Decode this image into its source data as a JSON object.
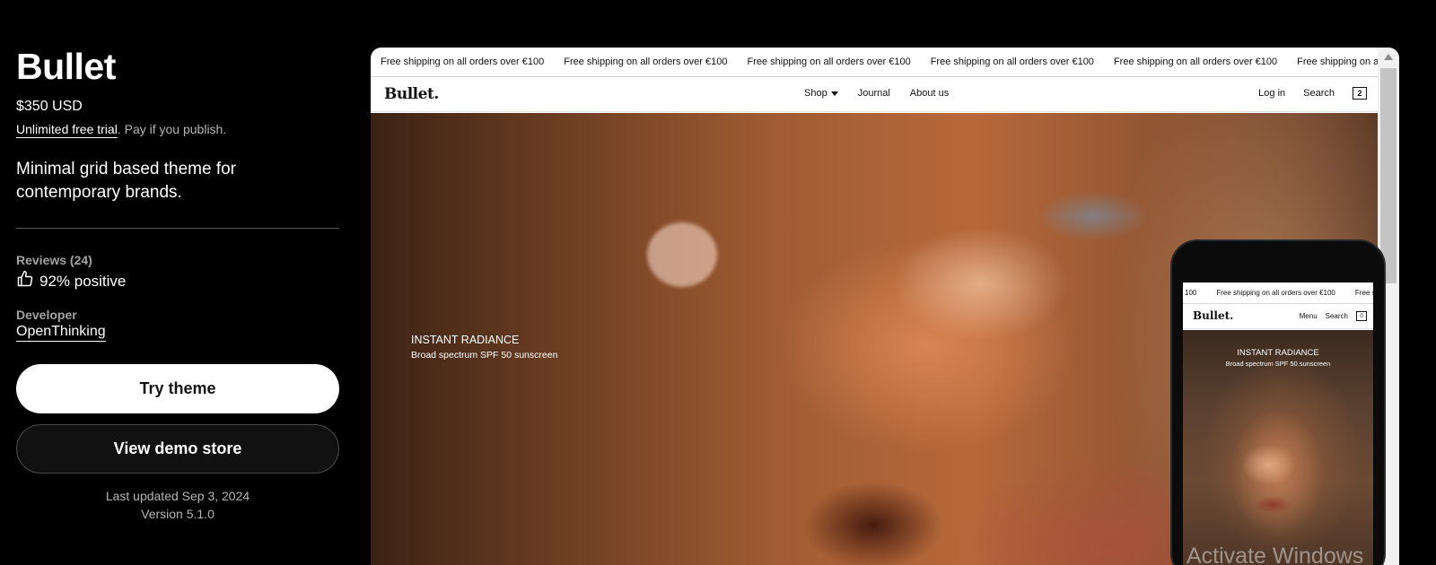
{
  "theme": {
    "name": "Bullet",
    "price": "$350 USD",
    "trial_link": "Unlimited free trial",
    "trial_rest": ". Pay if you publish.",
    "tagline": "Minimal grid based theme for contemporary brands.",
    "reviews_label": "Reviews (24)",
    "positive": "92% positive",
    "developer_label": "Developer",
    "developer_name": "OpenThinking",
    "try_button": "Try theme",
    "demo_button": "View demo store",
    "last_updated": "Last updated Sep 3, 2024",
    "version": "Version 5.1.0"
  },
  "desktop_preview": {
    "announcement": "Free shipping on all orders over €100",
    "logo": "Bullet.",
    "nav": [
      "Shop",
      "Journal",
      "About us"
    ],
    "login": "Log in",
    "search": "Search",
    "cart_count": "2",
    "hero_title": "INSTANT RADIANCE",
    "hero_subtitle": "Broad spectrum SPF 50 sunscreen"
  },
  "mobile_preview": {
    "announcement_fragment": "100",
    "announcement": "Free shipping on all orders over €100",
    "announcement_cut": "Free shipp",
    "logo": "Bullet.",
    "menu": "Menu",
    "search": "Search",
    "cart_count": "0",
    "hero_title": "INSTANT RADIANCE",
    "hero_subtitle": "Broad spectrum SPF 50 sunscreen"
  },
  "watermark": "Activate Windows",
  "colors": {
    "background": "#000000",
    "button_primary": "#ffffff",
    "button_secondary": "#111111",
    "muted_text": "#b5b5b5"
  }
}
